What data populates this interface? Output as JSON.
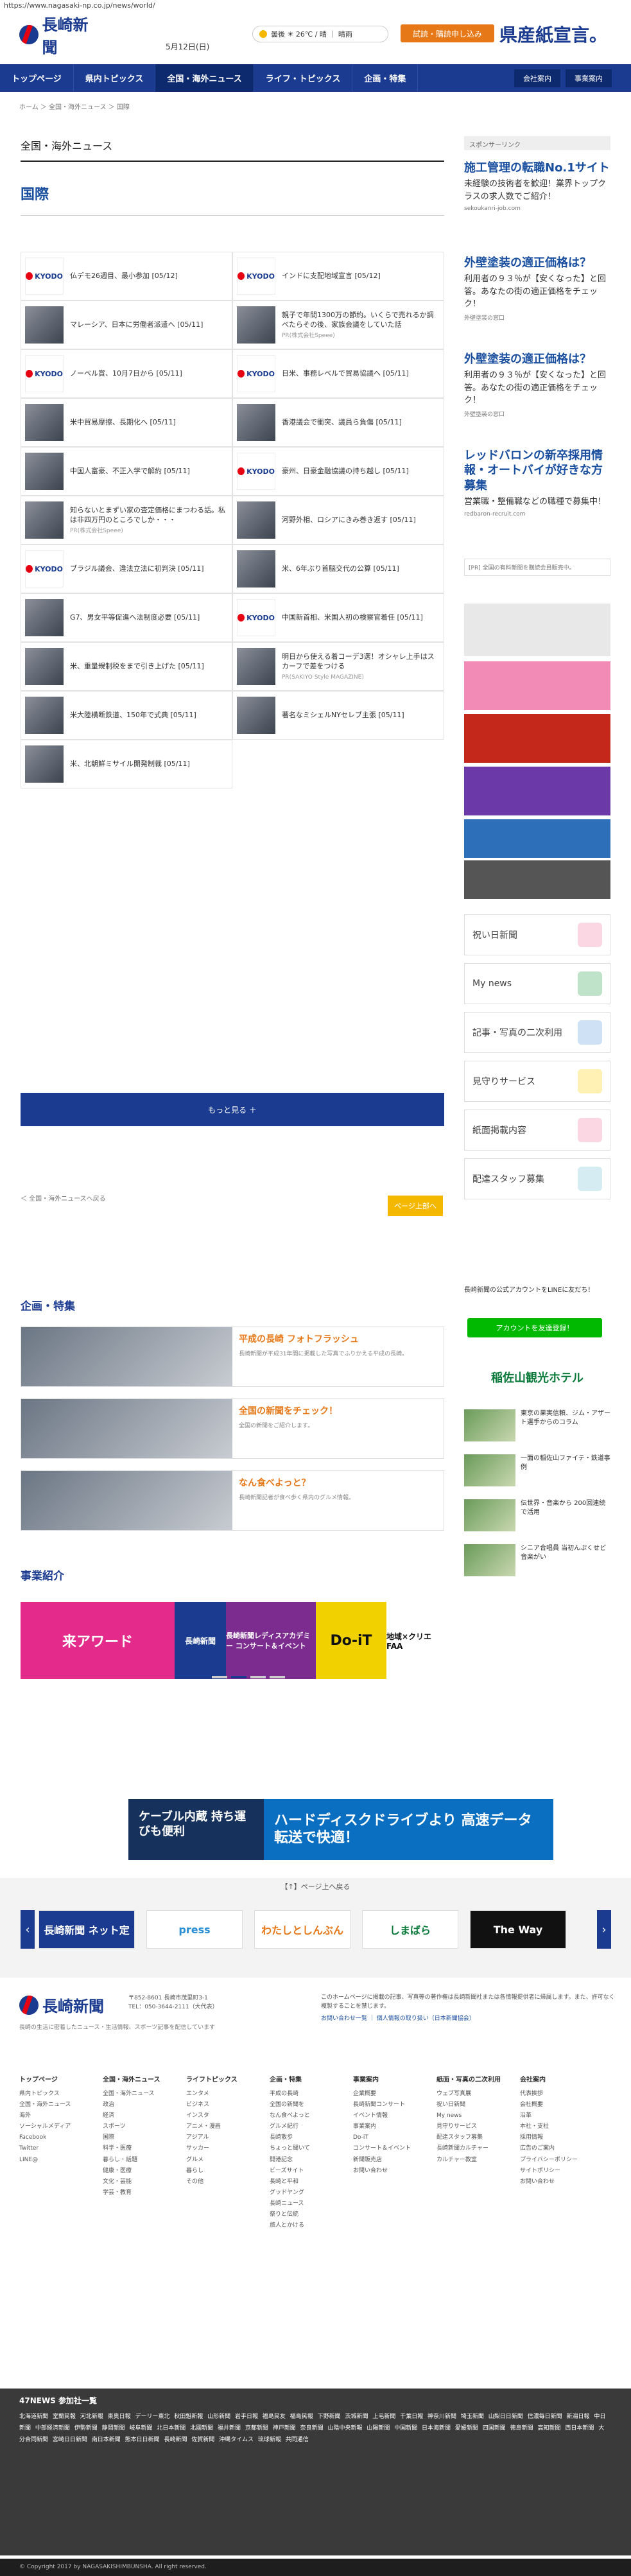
{
  "url": "https://www.nagasaki-np.co.jp/news/world/",
  "header": {
    "logo": "長崎新聞",
    "date": "5月12日(日)",
    "weather": "曇後 ☀ 26℃ / 晴 ｜ 晴雨",
    "trial_button": "試読・購読申し込み",
    "ad_text": "県産紙宣言。"
  },
  "nav": {
    "items": [
      "トップページ",
      "県内トピックス",
      "全国・海外ニュース",
      "ライフ・トピックス",
      "企画・特集"
    ],
    "active": "全国・海外ニュース",
    "right": [
      "会社案内",
      "事業案内"
    ]
  },
  "breadcrumb": "ホーム ＞ 全国・海外ニュース ＞ 国際",
  "page_title": "全国・海外ニュース",
  "section_title": "国際",
  "news": [
    {
      "title": "仏デモ26週目、最小参加 [05/12]",
      "thumb": "KYODO"
    },
    {
      "title": "インドに支配地域宣言 [05/12]",
      "thumb": "KYODO"
    },
    {
      "title": "マレーシア、日本に労働者派遣へ [05/11]",
      "thumb": "photo"
    },
    {
      "title": "親子で年間1300万の節約。いくらで売れるか調べたらその後、家族会議をしていた話",
      "sub": "PR(株式会社Speee)",
      "thumb": "photo"
    },
    {
      "title": "ノーベル賞、10月7日から [05/11]",
      "thumb": "KYODO"
    },
    {
      "title": "日米、事務レベルで貿易協議へ [05/11]",
      "thumb": "KYODO"
    },
    {
      "title": "米中貿易摩擦、長期化へ [05/11]",
      "thumb": "photo"
    },
    {
      "title": "香港議会で衝突、議員ら負傷 [05/11]",
      "thumb": "photo"
    },
    {
      "title": "中国人富豪、不正入学で解約 [05/11]",
      "thumb": "photo"
    },
    {
      "title": "豪州、日豪金融協議の持ち越し [05/11]",
      "thumb": "KYODO"
    },
    {
      "title": "知らないとまずい家の査定価格にまつわる話。私は非四万円のところでしか・・・",
      "sub": "PR(株式会社Speee)",
      "thumb": "photo"
    },
    {
      "title": "河野外相、ロシアにきみ巻き返す [05/11]",
      "thumb": "photo"
    },
    {
      "title": "ブラジル議会、違法立法に初判決 [05/11]",
      "thumb": "KYODO"
    },
    {
      "title": "米、6年ぶり首脳交代の公算 [05/11]",
      "thumb": "photo"
    },
    {
      "title": "G7、男女平等促進へ法制度必要 [05/11]",
      "thumb": "photo"
    },
    {
      "title": "中国新首相、米国人初の検察官着任 [05/11]",
      "thumb": "KYODO"
    },
    {
      "title": "米、重量規制税をまで引き上げた [05/11]",
      "thumb": "photo"
    },
    {
      "title": "明日から使える着コーデ3選！オシャレ上手はスカーフで差をつける",
      "sub": "PR(SAKIYO Style MAGAZINE)",
      "thumb": "photo"
    },
    {
      "title": "米大陸横断鉄道、150年で式典 [05/11]",
      "thumb": "photo"
    },
    {
      "title": "著名なミシェルNYセレブ主張 [05/11]",
      "thumb": "photo"
    },
    {
      "title": "米、北朝鮮ミサイル開発制裁 [05/11]",
      "thumb": "photo"
    }
  ],
  "more_button": "もっと見る ＋",
  "back_link": "＜ 全国・海外ニュースへ戻る",
  "top_link": "ページ上部へ",
  "features_title": "企画・特集",
  "features": [
    {
      "title": "平成の長崎 フォトフラッシュ",
      "desc": "長崎新聞が平成31年間に掲載した写真でふりかえる平成の長崎。"
    },
    {
      "title": "全国の新聞をチェック！",
      "desc": "全国の新聞をご紹介します。"
    },
    {
      "title": "なん食べよっと？",
      "desc": "長崎新聞記者が食べ歩く県内のグルメ情報。"
    }
  ],
  "business_title": "事業紹介",
  "carousel": [
    "来アワード",
    "長崎新聞",
    "長崎新聞レディスアカデミー コンサート＆イベント",
    "Do-iT",
    "地域×クリエ FAA"
  ],
  "sidebar": {
    "sponsor_label": "スポンサーリンク",
    "ads": [
      {
        "title": "施工管理の転職No.1サイト",
        "desc": "未経験の技術者を歓迎！業界トップクラスの求人数でご紹介！",
        "url": "sekoukanri-job.com"
      },
      {
        "title": "外壁塗装の適正価格は？",
        "desc": "利用者の９３％が【安くなった】と回答。あなたの街の適正価格をチェック！",
        "url": "外壁塗装の窓口"
      },
      {
        "title": "外壁塗装の適正価格は？",
        "desc": "利用者の９３％が【安くなった】と回答。あなたの街の適正価格をチェック！",
        "url": "外壁塗装の窓口"
      },
      {
        "title": "レッドバロンの新卒採用情報・オートバイが好きな方募集",
        "desc": "営業職・整備職などの職種で募集中！",
        "url": "redbaron-recruit.com"
      }
    ],
    "pr_note": "[PR] 全国の有料新聞を購読会員販売中。",
    "menu": [
      "祝い日新聞",
      "My news",
      "記事・写真の二次利用",
      "見守りサービス",
      "紙面掲載内容",
      "配達スタッフ募集"
    ],
    "line_title": "長崎新聞の公式アカウントをLINEに友だち！",
    "line_button": "アカウントを友達登録！",
    "hotel": "稲佐山観光ホテル",
    "side_news": [
      "東京の果実信頼、ジム・アザート選手からのコラム",
      "一面の稲佐山ファイテ・鉄道事例",
      "伝世界・音楽から 200回連続で活用",
      "シニア合唱員 当初んぷくせど音楽がい"
    ]
  },
  "wide_ad": {
    "left": "ケーブル内蔵 持ち運びも便利",
    "right": "ハードディスクドライブより 高速データ転送で快適！"
  },
  "pickup_label": "【↑】ページ上へ戻る",
  "pickup": [
    "長崎新聞 ネット定",
    "press",
    "わたしとしんぶん",
    "しまばら",
    "The Way"
  ],
  "footer": {
    "logo": "長崎新聞",
    "address": "〒852-8601 長崎市茂里町3-1",
    "tel": "TEL：050-3644-2111（大代表）",
    "desc": "長崎の生活に密着したニュース・生活情報、スポーツ記事を配信しています",
    "note": "このホームページに掲載の記事、写真等の著作権は長崎新聞社または各情報提供者に帰属します。また、許可なく複製することを禁じます。",
    "links": [
      "お問い合わせ一覧",
      "個人情報の取り扱い（日本新聞協会）"
    ],
    "columns": [
      {
        "title": "トップページ",
        "items": [
          "県内トピックス",
          "全国・海外ニュース",
          "海外",
          "ソーシャルメディア",
          "Facebook",
          "Twitter",
          "LINE@"
        ]
      },
      {
        "title": "全国・海外ニュース",
        "items": [
          "全国・海外ニュース",
          "政治",
          "経済",
          "スポーツ",
          "国際",
          "科学・医療",
          "暮らし・話題",
          "健康・医療",
          "文化・芸能",
          "学芸・教育"
        ]
      },
      {
        "title": "ライフトピックス",
        "items": [
          "エンタメ",
          "ビジネス",
          "インスタ",
          "アニメ・漫画",
          "アジアル",
          "サッカー",
          "グルメ",
          "暮らし",
          "その他"
        ]
      },
      {
        "title": "企画・特集",
        "items": [
          "平成の長崎",
          "全国の新聞を",
          "なん食べよっと",
          "グルメ紀行",
          "長崎散歩",
          "ちょっと聞いて",
          "開港記念",
          "ビーズサイト",
          "長崎と平和",
          "グッドヤング",
          "長崎ニュース",
          "祭りと伝統",
          "旅人とかける"
        ]
      },
      {
        "title": "事業案内",
        "items": [
          "企業概要",
          "長崎新聞コンサート",
          "イベント情報",
          "事業案内",
          "Do-iT",
          "コンサート＆イベント",
          "新聞販売店",
          "お問い合わせ"
        ]
      },
      {
        "title": "紙面・写真の二次利用",
        "items": [
          "ウェブ写真展",
          "祝い日新聞",
          "My news",
          "見守りサービス",
          "配達スタッフ募集",
          "長崎新聞カルチャー",
          "カルチャー教室"
        ]
      },
      {
        "title": "会社案内",
        "items": [
          "代表挨拶",
          "会社概要",
          "沿革",
          "本社・支社",
          "採用情報",
          "広告のご案内",
          "プライバシーポリシー",
          "サイトポリシー",
          "お問い合わせ"
        ]
      }
    ]
  },
  "n47": {
    "title": "47NEWS 参加社一覧",
    "list": "北海道新聞 室蘭民報 河北新報 東奥日報 デーリー東北 秋田魁新報 山形新聞 岩手日報 福島民友 福島民報 下野新聞 茨城新聞 上毛新聞 千葉日報 神奈川新聞 埼玉新聞 山梨日日新聞 信濃毎日新聞 新潟日報 中日新聞 中部経済新聞 伊勢新聞 静岡新聞 岐阜新聞 北日本新聞 北國新聞 福井新聞 京都新聞 神戸新聞 奈良新聞 山陰中央新報 山陽新聞 中国新聞 日本海新聞 愛媛新聞 四国新聞 徳島新聞 高知新聞 西日本新聞 大分合同新聞 宮崎日日新聞 南日本新聞 熊本日日新聞 長崎新聞 佐賀新聞 沖縄タイムス 琉球新報 共同通信"
  },
  "copyright": "© Copyright 2017 by NAGASAKISHIMBUNSHA. All right reserved."
}
